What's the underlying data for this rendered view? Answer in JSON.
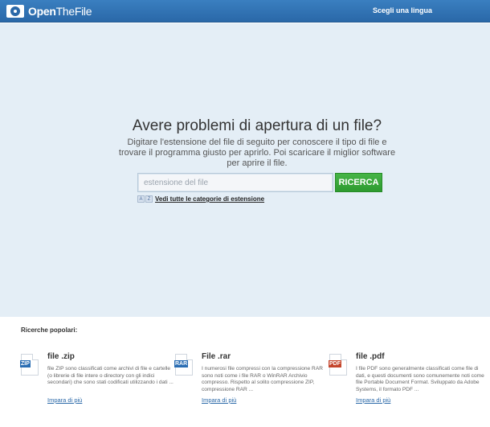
{
  "header": {
    "logo_bold": "Open",
    "logo_rest": "TheFile",
    "language_link": "Scegli una lingua"
  },
  "hero": {
    "title": "Avere problemi di apertura di un file?",
    "subtitle": "Digitare l'estensione del file di seguito per conoscere il tipo di file e trovare il programma giusto per aprirlo. Poi scaricare il miglior software per aprire il file.",
    "search_placeholder": "estensione del file",
    "search_value": "",
    "search_button": "RICERCA",
    "az_a": "A",
    "az_z": "Z",
    "categories_link": "Vedi tutte le categorie di estensione"
  },
  "popular": {
    "title": "Ricerche popolari:",
    "items": [
      {
        "icon": "zip-file-icon",
        "tag": "ZIP",
        "title": "file .zip",
        "description": "file ZIP sono classificati come archivi di file e cartelle (o librerie di file intere o directory con gli indici secondari) che sono stati codificati utilizzando i dati ...",
        "link": "Impara di più"
      },
      {
        "icon": "rar-file-icon",
        "tag": "RAR",
        "title": "File .rar",
        "description": "I numerosi file compressi con la compressione RAR sono noti come i file RAR o WinRAR Archivio compresso. Rispetto al solito compressione ZIP, compressione RAR ...",
        "link": "Impara di più"
      },
      {
        "icon": "pdf-file-icon",
        "tag": "PDF",
        "title": "file .pdf",
        "description": "I file PDF sono generalmente classificati come file di dati, e questi documenti sono comunemente noti come file Portable Document Format. Sviluppato da Adobe Systems, il formato PDF ...",
        "link": "Impara di più"
      }
    ]
  },
  "colors": {
    "header_blue": "#2a68a8",
    "hero_bg": "#e4eef6",
    "button_green": "#2d9a2f",
    "pdf_red": "#c4452c"
  }
}
